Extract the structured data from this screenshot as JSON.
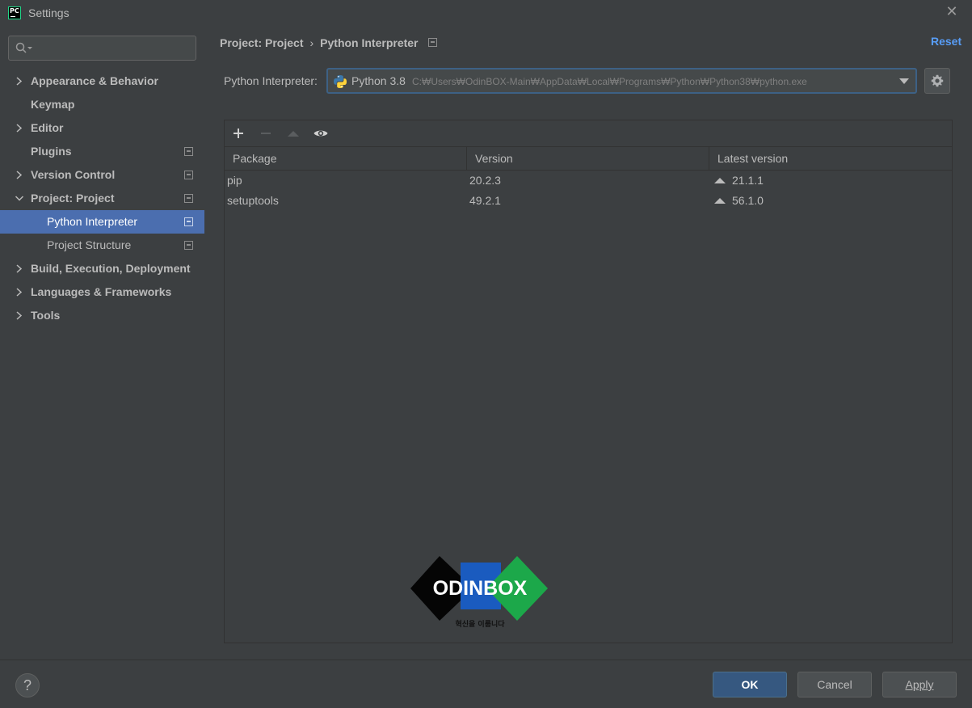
{
  "window": {
    "title": "Settings"
  },
  "sidebar": {
    "items": [
      {
        "label": "Appearance & Behavior",
        "expandable": true,
        "expanded": false,
        "bold": true
      },
      {
        "label": "Keymap",
        "expandable": false,
        "bold": true
      },
      {
        "label": "Editor",
        "expandable": true,
        "expanded": false,
        "bold": true
      },
      {
        "label": "Plugins",
        "expandable": false,
        "bold": true,
        "project_icon": true
      },
      {
        "label": "Version Control",
        "expandable": true,
        "expanded": false,
        "bold": true,
        "project_icon": true
      },
      {
        "label": "Project: Project",
        "expandable": true,
        "expanded": true,
        "bold": true,
        "project_icon": true
      },
      {
        "label": "Python Interpreter",
        "child": true,
        "selected": true,
        "project_icon": true
      },
      {
        "label": "Project Structure",
        "child": true,
        "project_icon": true
      },
      {
        "label": "Build, Execution, Deployment",
        "expandable": true,
        "expanded": false,
        "bold": true
      },
      {
        "label": "Languages & Frameworks",
        "expandable": true,
        "expanded": false,
        "bold": true
      },
      {
        "label": "Tools",
        "expandable": true,
        "expanded": false,
        "bold": true
      }
    ]
  },
  "header": {
    "breadcrumb": [
      "Project: Project",
      "Python Interpreter"
    ],
    "reset_label": "Reset"
  },
  "interpreter": {
    "label": "Python Interpreter:",
    "name": "Python 3.8",
    "path": "C:₩Users₩OdinBOX-Main₩AppData₩Local₩Programs₩Python₩Python38₩python.exe"
  },
  "packages": {
    "columns": [
      "Package",
      "Version",
      "Latest version"
    ],
    "rows": [
      {
        "package": "pip",
        "version": "20.2.3",
        "latest": "21.1.1",
        "upgrade_available": true
      },
      {
        "package": "setuptools",
        "version": "49.2.1",
        "latest": "56.1.0",
        "upgrade_available": true
      }
    ]
  },
  "watermark": {
    "text": "ODINBOX",
    "tagline": "혁신을 이룹니다"
  },
  "footer": {
    "help_label": "?",
    "ok_label": "OK",
    "cancel_label": "Cancel",
    "apply_label": "Apply"
  },
  "colors": {
    "background": "#3c3f41",
    "selection": "#4b6eaf",
    "link": "#589df6",
    "primary_button": "#365880"
  }
}
